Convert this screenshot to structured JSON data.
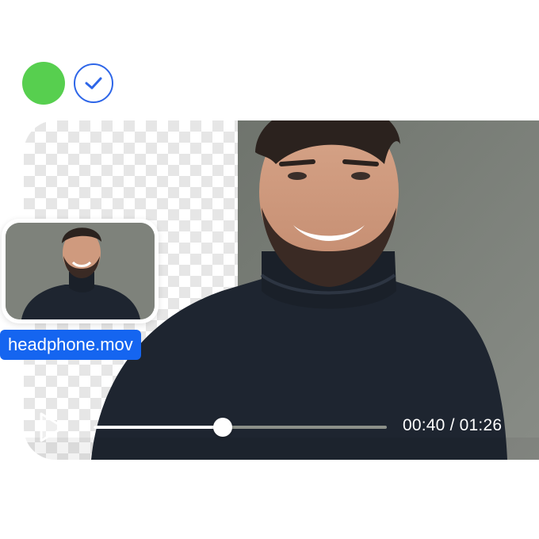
{
  "status": {
    "active_color": "#57cf4f",
    "check_icon": "check-icon",
    "accent": "#2e66e8"
  },
  "player": {
    "time_readout": "00:40 / 01:26",
    "progress_fraction": 0.44,
    "play_icon": "play-icon"
  },
  "thumbnail": {
    "filename": "headphone.mov",
    "label_color": "#1565f0"
  }
}
